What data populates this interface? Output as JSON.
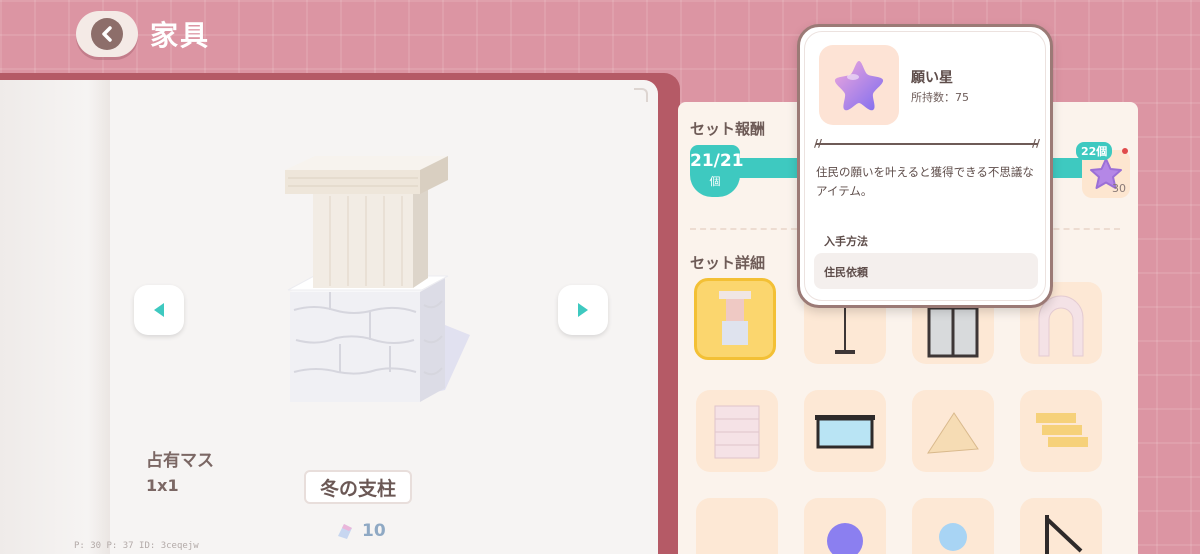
{
  "header": {
    "title": "家具"
  },
  "item": {
    "name": "冬の支柱",
    "occupancy_label": "占有マス",
    "occupancy_value": "1x1",
    "cost": "10"
  },
  "debug_text": "P: 30    P: 37    ID: 3ceqejw",
  "set_reward": {
    "label": "セット報酬",
    "progress": "21/21",
    "unit": "個",
    "reward_count": "22個",
    "reward_qty": "30"
  },
  "set_detail": {
    "label": "セット詳細"
  },
  "popup": {
    "name": "願い星",
    "owned": "所持数：75",
    "description": "住民の願いを叶えると獲得できる不思議なアイテム。",
    "source_label": "入手方法",
    "source": "住民依頼"
  },
  "colors": {
    "background": "#dc95a3",
    "accent_teal": "#3ec9c0",
    "selected_tile": "#fbd66e"
  }
}
